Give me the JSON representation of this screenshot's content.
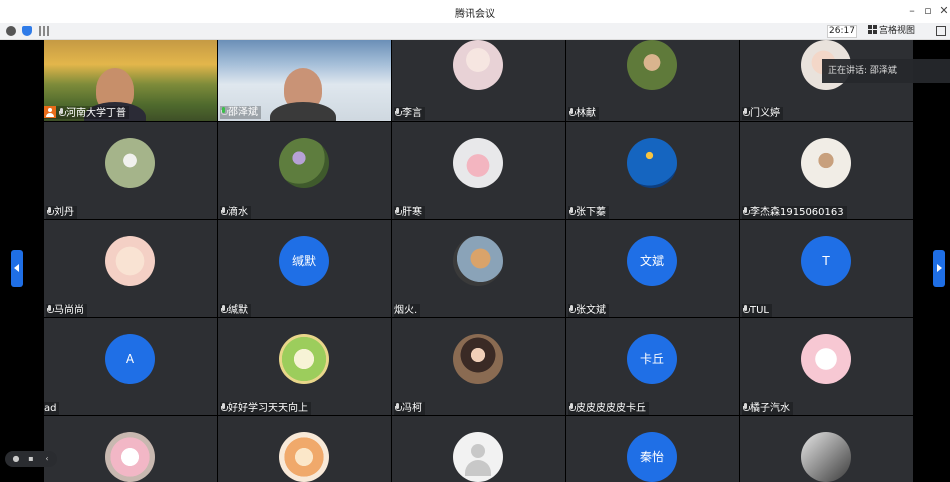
{
  "window": {
    "title": "腾讯会议"
  },
  "infobar": {
    "timer": "26:17",
    "view_label": "宫格视图"
  },
  "toast": {
    "text": "正在讲话: 邵泽斌"
  },
  "tiles": [
    {
      "name": "河南大学丁普",
      "avatar": "video"
    },
    {
      "name": "邵泽斌",
      "avatar": "video"
    },
    {
      "name": "李言",
      "avatar": "photo"
    },
    {
      "name": "林献",
      "avatar": "photo"
    },
    {
      "name": "门义婷",
      "avatar": "photo"
    },
    {
      "name": "刘丹",
      "avatar": "photo"
    },
    {
      "name": "滴水",
      "avatar": "photo"
    },
    {
      "name": "肝寒",
      "avatar": "photo"
    },
    {
      "name": "张下蓁",
      "avatar": "photo"
    },
    {
      "name": "李杰森1915060163",
      "avatar": "photo"
    },
    {
      "name": "马尚尚",
      "avatar": "photo"
    },
    {
      "name": "缄默",
      "avatar": "text",
      "avatar_text": "缄默"
    },
    {
      "name": "烟火.",
      "avatar": "photo"
    },
    {
      "name": "张文斌",
      "avatar": "text",
      "avatar_text": "文斌"
    },
    {
      "name": "TUL",
      "avatar": "text",
      "avatar_text": "T"
    },
    {
      "name": "ad",
      "avatar": "text",
      "avatar_text": "A"
    },
    {
      "name": "好好学习天天向上",
      "avatar": "photo"
    },
    {
      "name": "冯柯",
      "avatar": "photo"
    },
    {
      "name": "皮皮皮皮皮卡丘",
      "avatar": "text",
      "avatar_text": "卡丘"
    },
    {
      "name": "橘子汽水",
      "avatar": "photo"
    },
    {
      "name": "",
      "avatar": "photo"
    },
    {
      "name": "",
      "avatar": "photo"
    },
    {
      "name": "",
      "avatar": "default"
    },
    {
      "name": "",
      "avatar": "text",
      "avatar_text": "秦怡"
    },
    {
      "name": "",
      "avatar": "photo"
    }
  ],
  "colors": {
    "accent": "#1f6fe6",
    "tile_bg": "#2d2f33",
    "host_badge": "#e86c1a",
    "mic_active": "#3bbf4a"
  }
}
